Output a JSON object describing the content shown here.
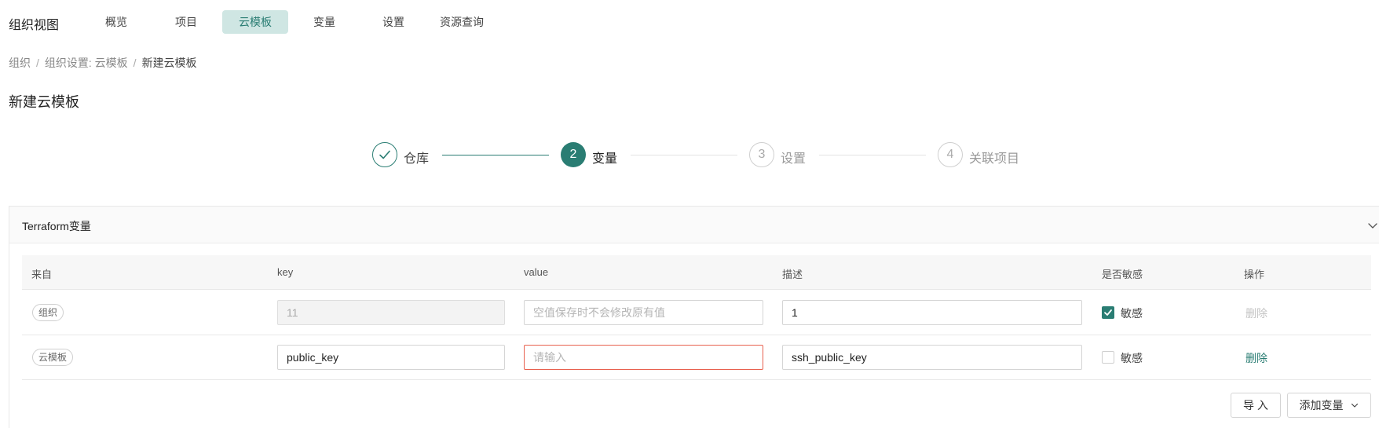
{
  "brand": "组织视图",
  "nav": {
    "items": [
      {
        "label": "概览"
      },
      {
        "label": "项目"
      },
      {
        "label": "云模板",
        "active": true
      },
      {
        "label": "变量"
      },
      {
        "label": "设置"
      },
      {
        "label": "资源查询"
      }
    ]
  },
  "breadcrumb": {
    "items": [
      "组织",
      "组织设置: 云模板",
      "新建云模板"
    ],
    "separator": "/"
  },
  "page_title": "新建云模板",
  "steps": [
    {
      "label": "仓库",
      "state": "done",
      "icon": "check-icon"
    },
    {
      "number": "2",
      "label": "变量",
      "state": "current"
    },
    {
      "number": "3",
      "label": "设置",
      "state": "wait"
    },
    {
      "number": "4",
      "label": "关联项目",
      "state": "wait"
    }
  ],
  "panel": {
    "title": "Terraform变量",
    "collapse_icon": "chevron-down-icon"
  },
  "table": {
    "columns": [
      "来自",
      "key",
      "value",
      "描述",
      "是否敏感",
      "操作"
    ],
    "rows": [
      {
        "source": "组织",
        "key": "11",
        "key_disabled": true,
        "value": "",
        "value_placeholder": "空值保存时不会修改原有值",
        "description": "1",
        "sensitive": true,
        "sensitive_label": "敏感",
        "action": "删除",
        "action_enabled": false
      },
      {
        "source": "云模板",
        "key": "public_key",
        "key_disabled": false,
        "value": "",
        "value_placeholder": "请输入",
        "value_error": true,
        "description": "ssh_public_key",
        "sensitive": false,
        "sensitive_label": "敏感",
        "action": "删除",
        "action_enabled": true
      }
    ]
  },
  "buttons": {
    "import_label": "导 入",
    "add_variable_label": "添加变量"
  },
  "colors": {
    "primary": "#2a7d73",
    "nav_active_bg": "#cfe6e3",
    "error_border": "#e8614f"
  }
}
